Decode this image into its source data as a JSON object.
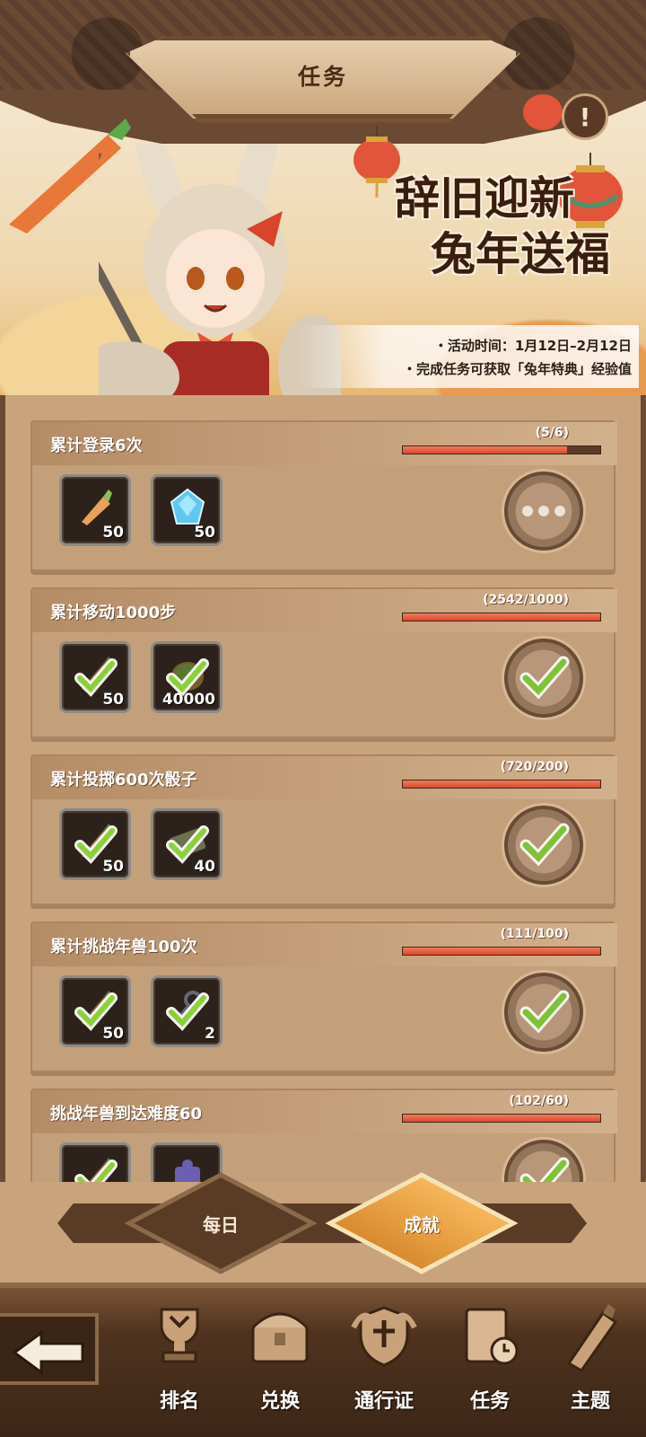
{
  "header": {
    "title": "任务"
  },
  "banner": {
    "headline_line1": "辞旧迎新",
    "headline_line2": "兔年送福",
    "info_lines": [
      "・活动时间：1月12日–2月12日",
      "・完成任务可获取「兔年特典」经验值"
    ],
    "alert_icon": "exclamation-icon"
  },
  "tasks": [
    {
      "name": "累计登录6次",
      "progress_text": "(5/6)",
      "progress": 0.83,
      "status": "in-progress",
      "rewards": [
        {
          "icon": "carrot-icon",
          "qty": "50",
          "claimed": false
        },
        {
          "icon": "gem-icon",
          "qty": "50",
          "claimed": false
        }
      ]
    },
    {
      "name": "累计移动1000步",
      "progress_text": "(2542/1000)",
      "progress": 1.0,
      "status": "completed",
      "rewards": [
        {
          "icon": "carrot-icon",
          "qty": "50",
          "claimed": true
        },
        {
          "icon": "coin-icon",
          "qty": "40000",
          "claimed": true
        }
      ]
    },
    {
      "name": "累计投掷600次骰子",
      "progress_text": "(720/200)",
      "progress": 1.0,
      "status": "completed",
      "rewards": [
        {
          "icon": "carrot-icon",
          "qty": "50",
          "claimed": true
        },
        {
          "icon": "ticket-icon",
          "qty": "40",
          "claimed": true
        }
      ]
    },
    {
      "name": "累计挑战年兽100次",
      "progress_text": "(111/100)",
      "progress": 1.0,
      "status": "completed",
      "rewards": [
        {
          "icon": "carrot-icon",
          "qty": "50",
          "claimed": true
        },
        {
          "icon": "key-icon",
          "qty": "2",
          "claimed": true
        }
      ]
    },
    {
      "name": "挑战年兽到达难度60",
      "progress_text": "(102/60)",
      "progress": 1.0,
      "status": "completed",
      "rewards": [
        {
          "icon": "carrot-icon",
          "qty": "",
          "claimed": true
        },
        {
          "icon": "puzzle-icon",
          "qty": "",
          "claimed": false
        }
      ]
    }
  ],
  "tabs": {
    "daily": "每日",
    "achievement": "成就",
    "active": "achievement"
  },
  "bottom_nav": [
    {
      "label": "排名",
      "icon": "trophy-icon"
    },
    {
      "label": "兑换",
      "icon": "chest-icon"
    },
    {
      "label": "通行证",
      "icon": "shield-icon"
    },
    {
      "label": "任务",
      "icon": "scroll-icon"
    },
    {
      "label": "主题",
      "icon": "theme-icon"
    }
  ],
  "colors": {
    "progress_fill": "#e2553a",
    "panel_bg": "#c9a37b",
    "frame": "#6b4a34",
    "active_tab": "#f2a94a",
    "check": "#8ccf3a"
  }
}
